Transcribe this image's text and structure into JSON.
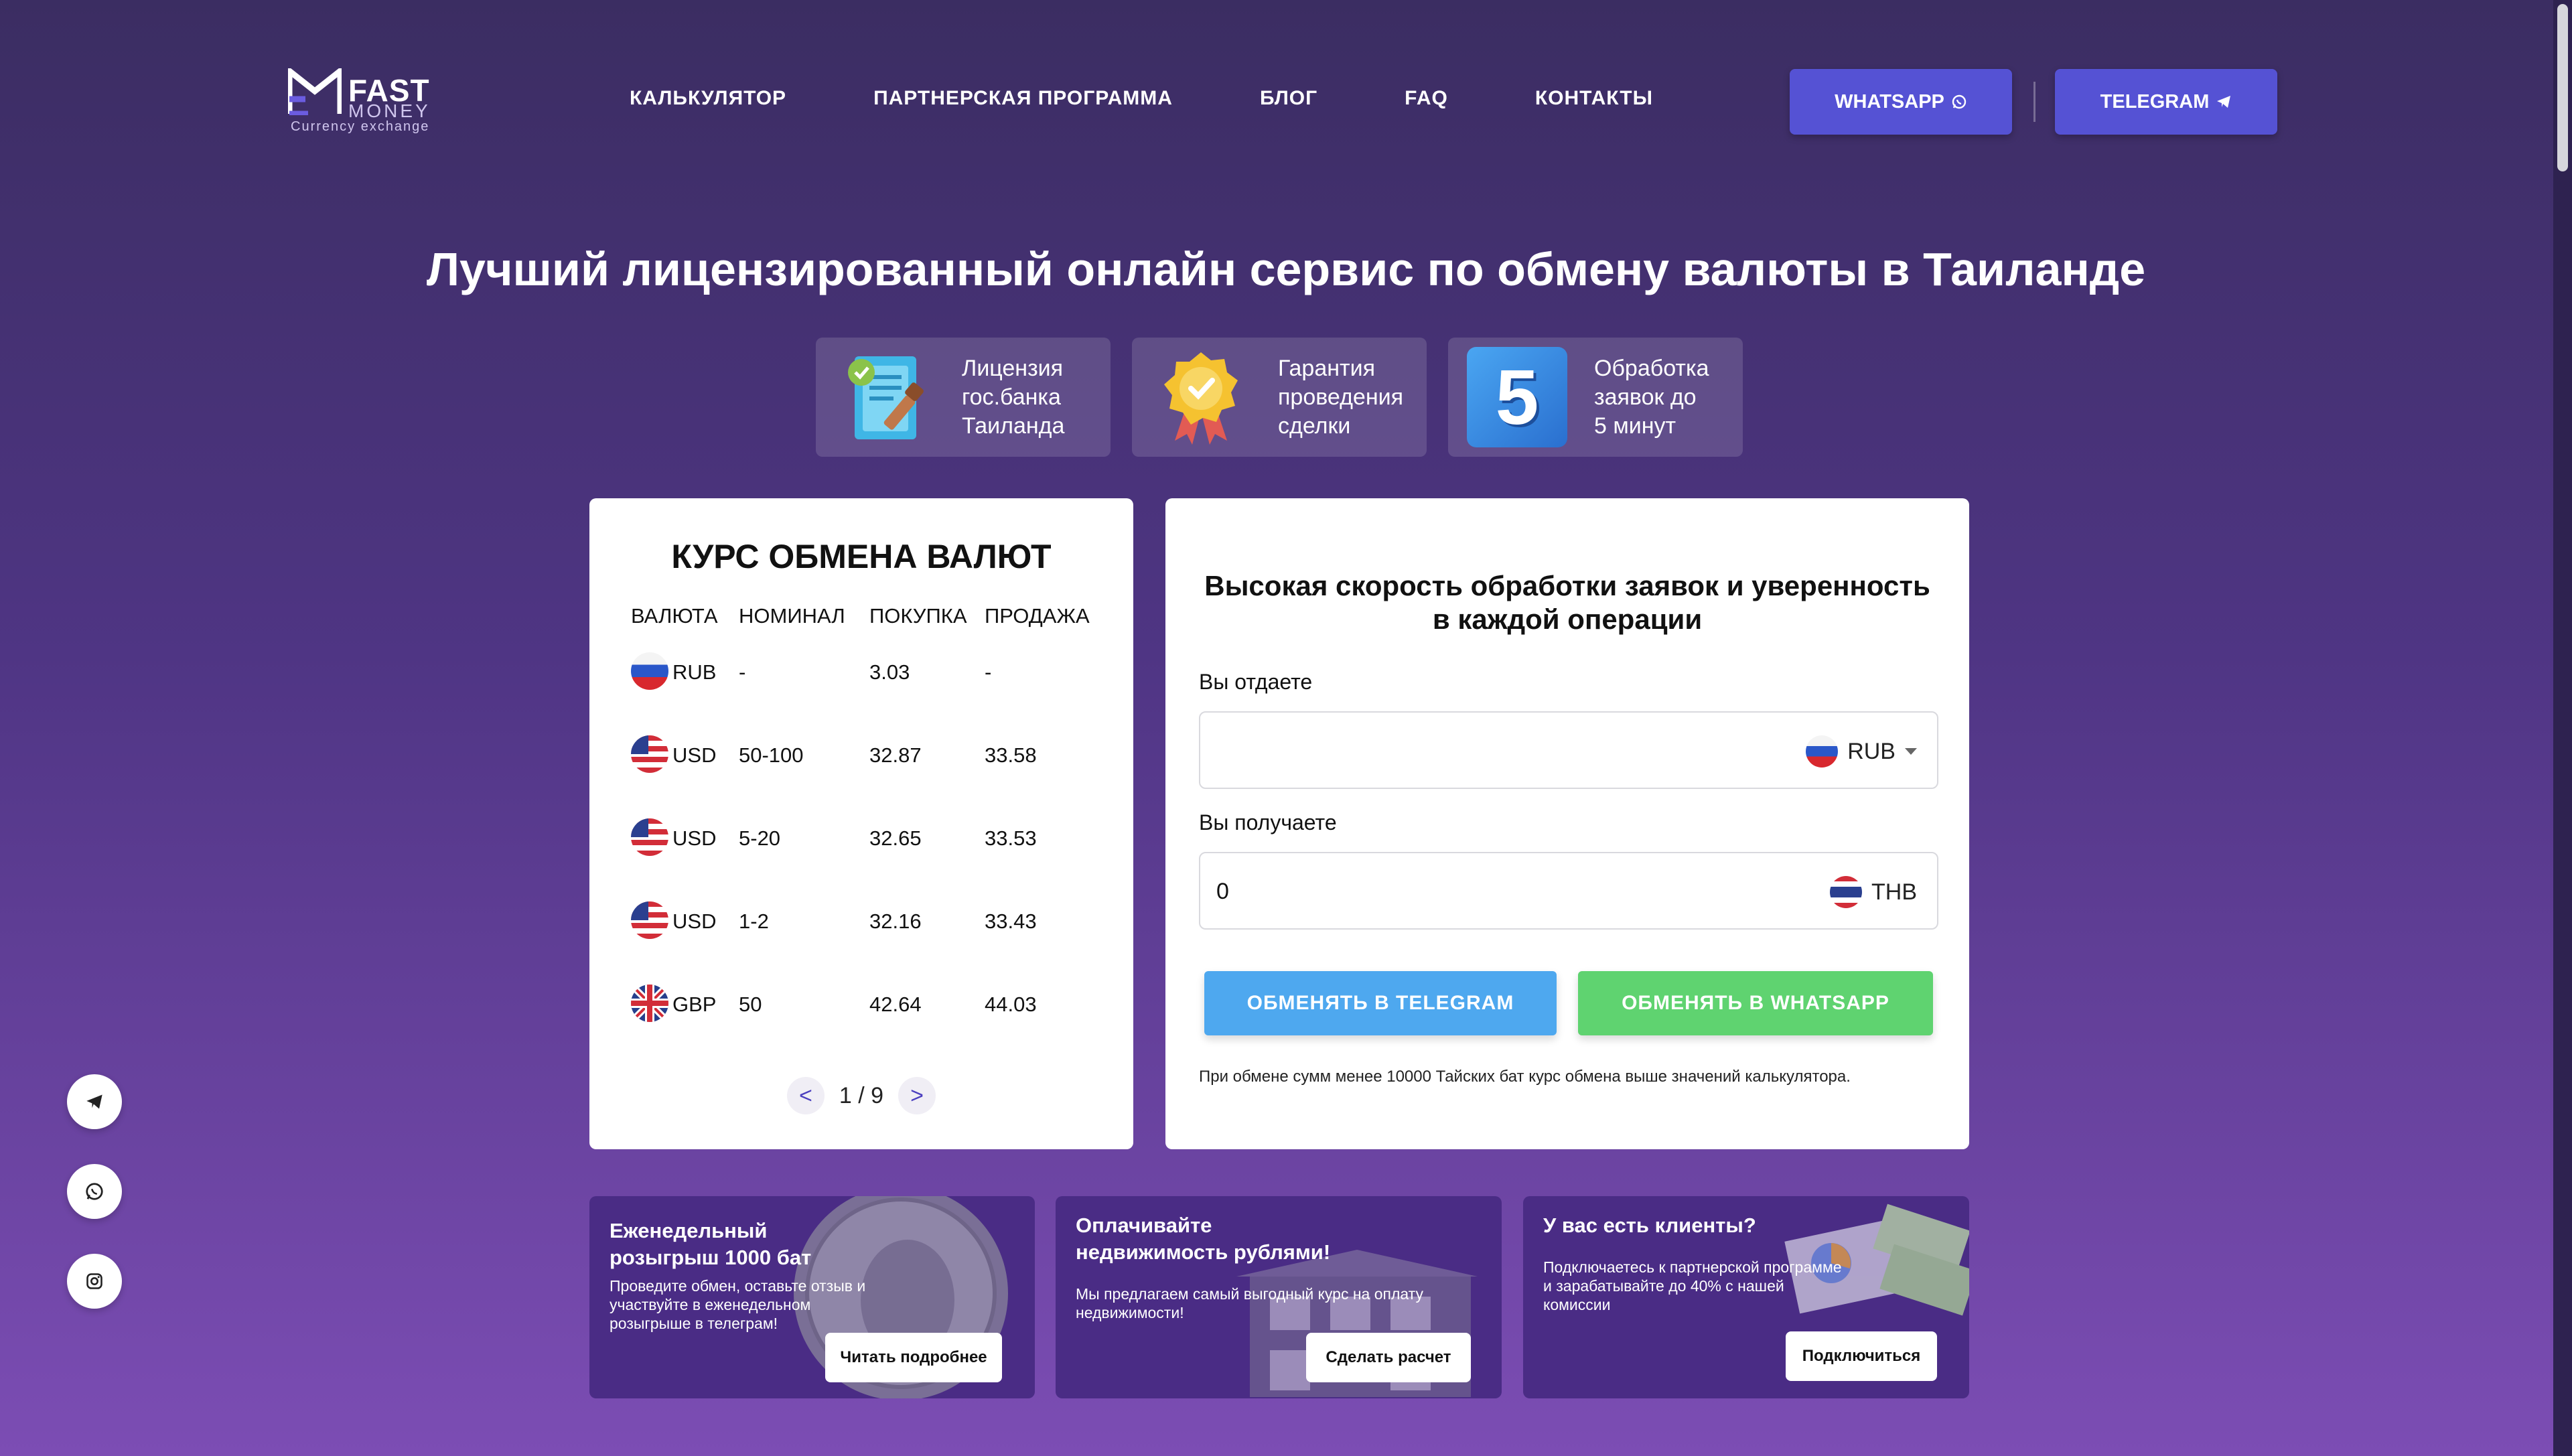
{
  "colors": {
    "accent_button": "#5552d4",
    "telegram_blue": "#4ea8ef",
    "whatsapp_green": "#5fd370",
    "card_bg": "#ffffff",
    "promo_bg": "#4a2c85"
  },
  "brand": {
    "name_top": "FAST",
    "name_bottom": "MONEY",
    "tagline": "Currency exchange"
  },
  "nav": {
    "items": [
      "КАЛЬКУЛЯТОР",
      "ПАРТНЕРСКАЯ ПРОГРАММА",
      "БЛОГ",
      "FAQ",
      "КОНТАКТЫ"
    ]
  },
  "header_buttons": {
    "whatsapp": "WHATSAPP",
    "telegram": "TELEGRAM"
  },
  "hero": {
    "title": "Лучший лицензированный онлайн сервис по обмену валюты в Таиланде"
  },
  "features": [
    {
      "icon": "license-document-icon",
      "lines": [
        "Лицензия",
        "гос.банка",
        "Таиланда"
      ]
    },
    {
      "icon": "guarantee-medal-icon",
      "lines": [
        "Гарантия",
        "проведения",
        "сделки"
      ]
    },
    {
      "icon": "number-five-icon",
      "number": "5",
      "lines": [
        "Обработка",
        "заявок до",
        "5 минут"
      ]
    }
  ],
  "rates": {
    "title": "КУРС ОБМЕНА ВАЛЮТ",
    "headers": [
      "ВАЛЮТА",
      "НОМИНАЛ",
      "ПОКУПКА",
      "ПРОДАЖА"
    ],
    "rows": [
      {
        "flag": "ru",
        "code": "RUB",
        "nominal": "-",
        "buy": "3.03",
        "sell": "-"
      },
      {
        "flag": "us",
        "code": "USD",
        "nominal": "50-100",
        "buy": "32.87",
        "sell": "33.58"
      },
      {
        "flag": "us",
        "code": "USD",
        "nominal": "5-20",
        "buy": "32.65",
        "sell": "33.53"
      },
      {
        "flag": "us",
        "code": "USD",
        "nominal": "1-2",
        "buy": "32.16",
        "sell": "33.43"
      },
      {
        "flag": "gb",
        "code": "GBP",
        "nominal": "50",
        "buy": "42.64",
        "sell": "44.03"
      }
    ],
    "pager": {
      "prev": "<",
      "next": ">",
      "current": "1 / 9"
    }
  },
  "calculator": {
    "title": "Высокая скорость обработки заявок и уверенность в каждой операции",
    "give_label": "Вы отдаете",
    "give_value": "",
    "give_currency": "RUB",
    "get_label": "Вы получаете",
    "get_value": "0",
    "get_currency": "THB",
    "btn_telegram": "ОБМЕНЯТЬ В TELEGRAM",
    "btn_whatsapp": "ОБМЕНЯТЬ В WHATSAPP",
    "note": "При обмене сумм менее 10000 Тайских бат курс обмена выше значений калькулятора."
  },
  "promos": [
    {
      "title_lines": [
        "Еженедельный",
        "розыгрыш 1000 бат"
      ],
      "text_lines": [
        "Проведите обмен, оставьте отзыв и",
        "участвуйте в еженедельном",
        "розыгрыше в телеграм!"
      ],
      "button": "Читать подробнее"
    },
    {
      "title_lines": [
        "Оплачивайте",
        "недвижимость рублями!"
      ],
      "text_lines": [
        "Мы предлагаем самый выгодный курс на оплату",
        "недвижимости!"
      ],
      "button": "Сделать расчет"
    },
    {
      "title_lines": [
        "У вас есть клиенты?"
      ],
      "text_lines": [
        "Подключаетесь к партнерской программе",
        "и зарабатывайте до 40% с нашей",
        "комиссии"
      ],
      "button": "Подключиться"
    }
  ]
}
